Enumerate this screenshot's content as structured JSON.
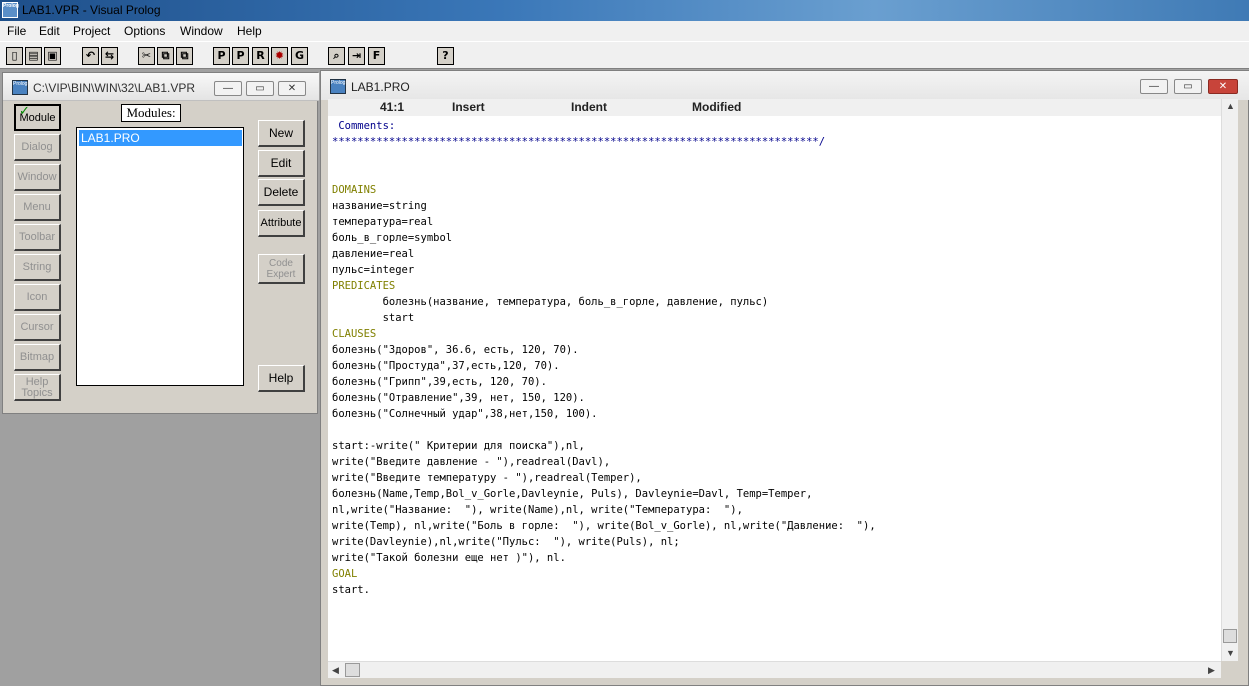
{
  "app": {
    "title": "LAB1.VPR - Visual Prolog",
    "icon": "prolog-app-icon"
  },
  "menu": [
    "File",
    "Edit",
    "Project",
    "Options",
    "Window",
    "Help"
  ],
  "toolbar": {
    "buttons": [
      "new-file-icon",
      "open-file-icon",
      "save-icon",
      "undo-icon",
      "redo-icon",
      "cut-icon",
      "copy-icon",
      "paste-icon",
      "P",
      "P",
      "R",
      "bug-icon",
      "G",
      "find-icon",
      "replace-icon",
      "F",
      "?"
    ]
  },
  "project": {
    "title": "C:\\VIP\\BIN\\WIN\\32\\LAB1.VPR",
    "modules_label": "Modules:",
    "modules": [
      "LAB1.PRO"
    ],
    "side_buttons": [
      "Module",
      "Dialog",
      "Window",
      "Menu",
      "Toolbar",
      "String",
      "Icon",
      "Cursor",
      "Bitmap",
      "Help Topics"
    ],
    "right_buttons": [
      "New",
      "Edit",
      "Delete",
      "Attribute",
      "Code Expert",
      "Help"
    ]
  },
  "editor": {
    "title": "LAB1.PRO",
    "status": {
      "pos": "41:1",
      "mode": "Insert",
      "indent": "Indent",
      "modified": "Modified"
    },
    "lines": [
      " Comments:",
      "*****************************************************************************/",
      "",
      "",
      "DOMAINS",
      "название=string",
      "температура=real",
      "боль_в_горле=symbol",
      "давление=real",
      "пульс=integer",
      "PREDICATES",
      "        болезнь(название, температура, боль_в_горле, давление, пульс)",
      "        start",
      "CLAUSES",
      "болезнь(\"Здоров\", 36.6, есть, 120, 70).",
      "болезнь(\"Простуда\",37,есть,120, 70).",
      "болезнь(\"Грипп\",39,есть, 120, 70).",
      "болезнь(\"Отравление\",39, нет, 150, 120).",
      "болезнь(\"Солнечный удар\",38,нет,150, 100).",
      "",
      "start:-write(\" Критерии для поиска\"),nl,",
      "write(\"Введите давление - \"),readreal(Davl),",
      "write(\"Введите температуру - \"),readreal(Temper),",
      "болезнь(Name,Temp,Bol_v_Gorle,Davleynie, Puls), Davleynie=Davl, Temp=Temper,",
      "nl,write(\"Название:  \"), write(Name),nl, write(\"Температура:  \"),",
      "write(Temp), nl,write(\"Боль в горле:  \"), write(Bol_v_Gorle), nl,write(\"Давление:  \"),",
      "write(Davleynie),nl,write(\"Пульс:  \"), write(Puls), nl;",
      "write(\"Такой болезни еще нет )\"), nl.",
      "GOAL",
      "start."
    ]
  }
}
